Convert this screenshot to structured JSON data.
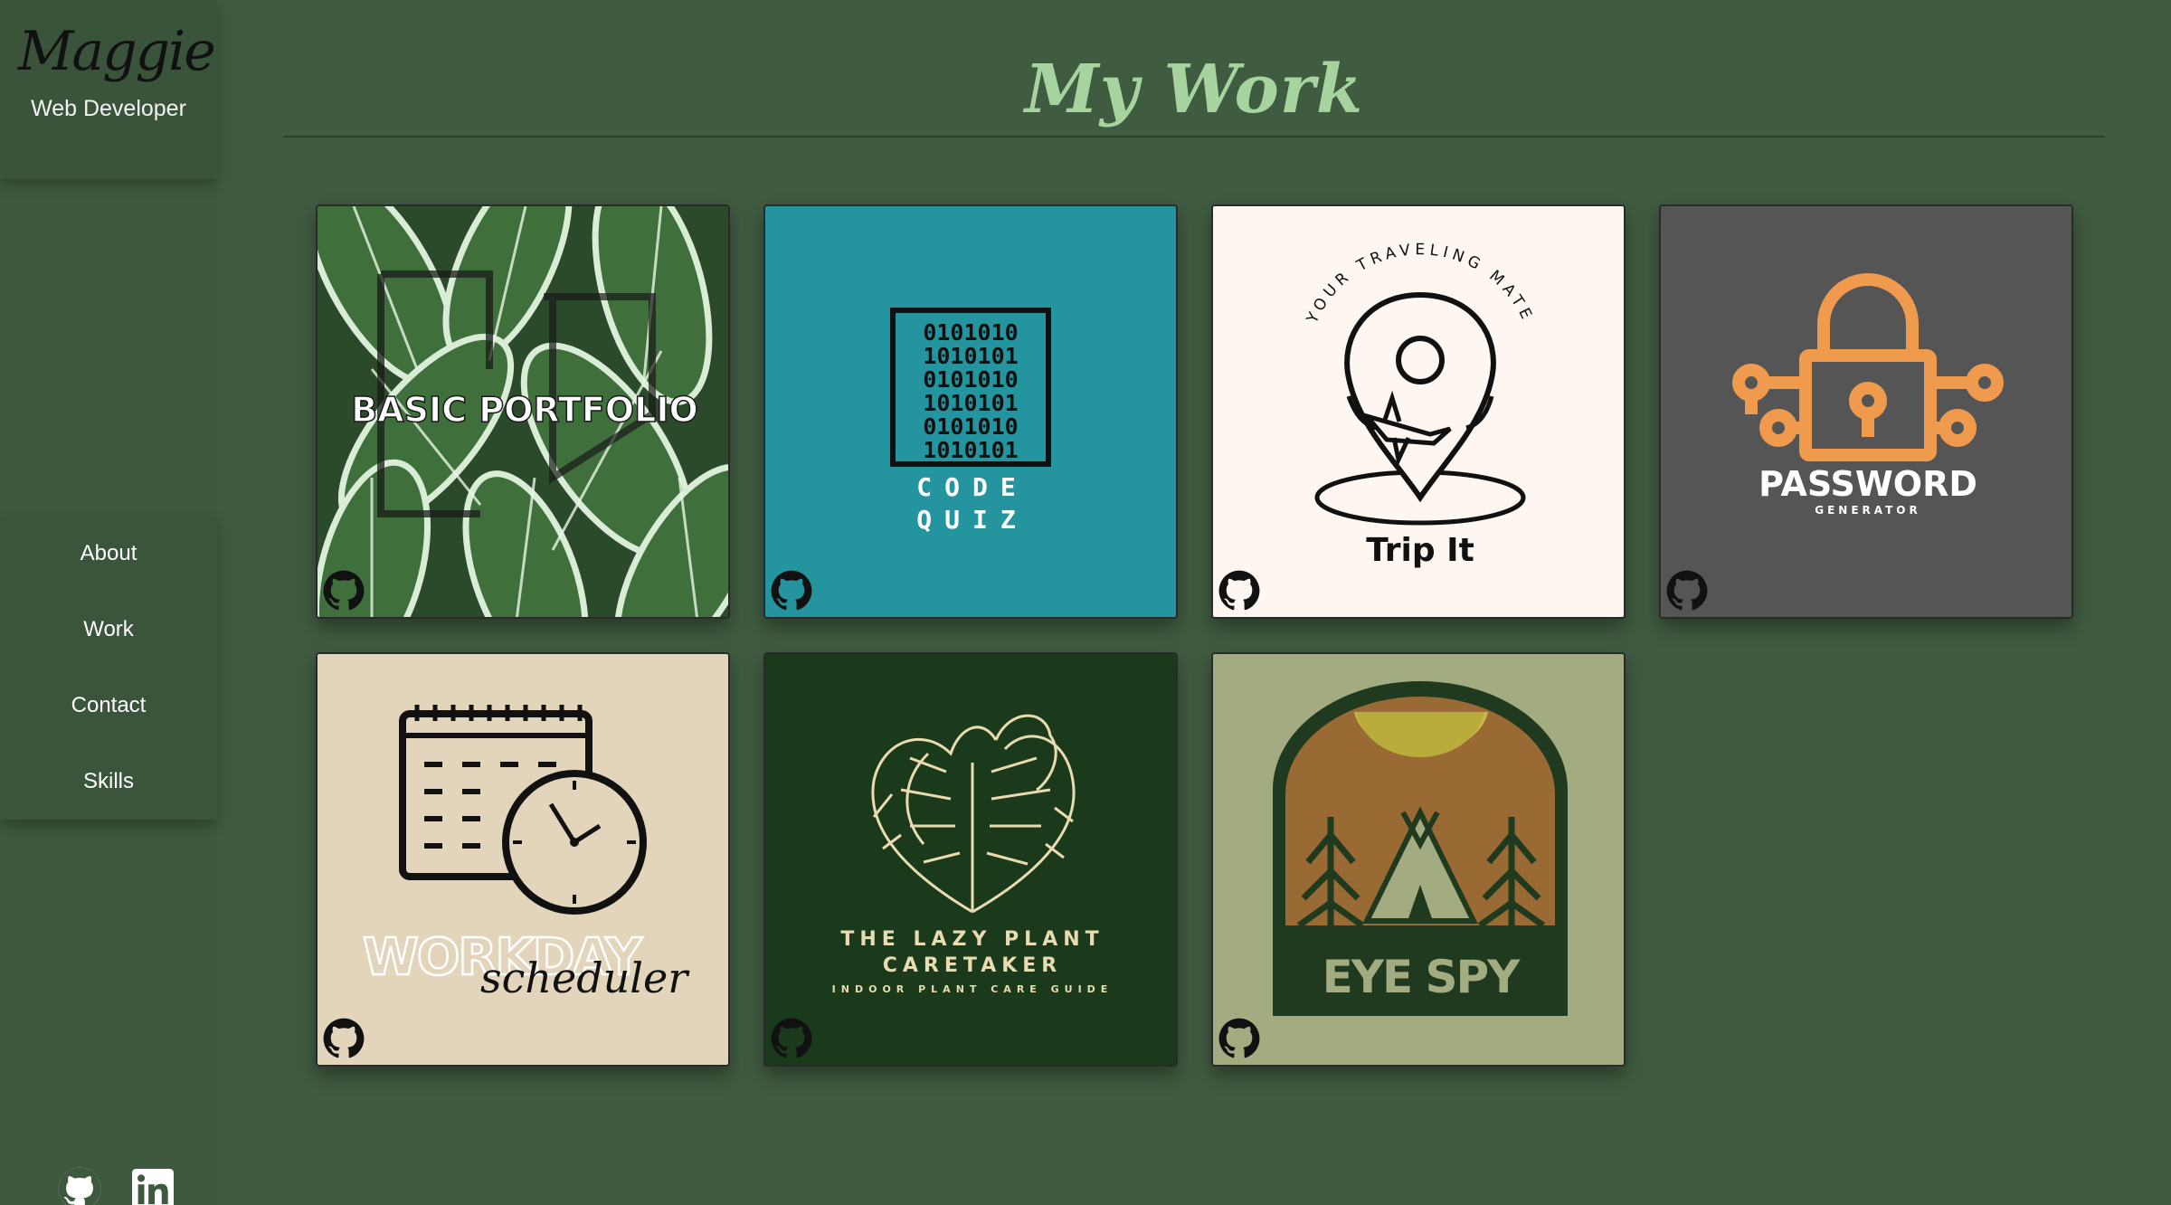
{
  "brand": {
    "name": "Maggie",
    "role": "Web Developer"
  },
  "nav": [
    {
      "label": "About"
    },
    {
      "label": "Work"
    },
    {
      "label": "Contact"
    },
    {
      "label": "Skills"
    }
  ],
  "social": {
    "icons": [
      "github-icon",
      "linkedin-icon"
    ]
  },
  "page": {
    "title": "My Work"
  },
  "projects": [
    {
      "title": "BASIC PORTFOLIO",
      "bg": "#2f4f2c"
    },
    {
      "title": "CODE QUIZ",
      "line1": "CODE",
      "line2": "QUIZ",
      "bg": "#24959f"
    },
    {
      "title": "Trip It",
      "tagline": "YOUR TRAVELING MATE",
      "bg": "#fdf6f1"
    },
    {
      "title": "PASSWORD",
      "subtitle": "GENERATOR",
      "bg": "#555555",
      "accent": "#f09a4e"
    },
    {
      "title": "scheduler",
      "prefix": "WORKDAY",
      "bg": "#e2d5bb"
    },
    {
      "line1": "THE LAZY PLANT",
      "line2": "CARETAKER",
      "subtitle": "INDOOR PLANT CARE GUIDE",
      "bg": "#1b3a1c",
      "accent": "#e8dcb0"
    },
    {
      "title": "EYE SPY",
      "bg": "#a3ab80",
      "accent": "#1f3a1f"
    }
  ],
  "colors": {
    "background": "#3f5b40",
    "title": "#a7d39f"
  }
}
